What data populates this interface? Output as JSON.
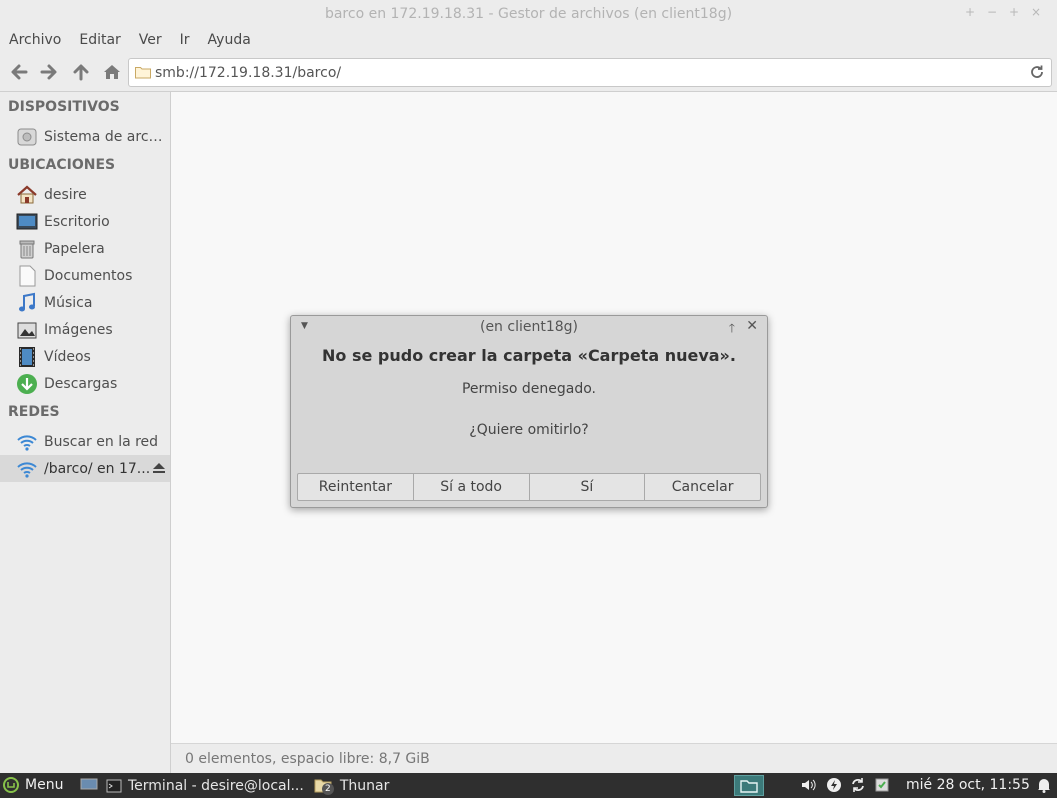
{
  "window": {
    "title": "barco en 172.19.18.31 - Gestor de archivos (en client18g)",
    "controls": [
      "minimize",
      "maximize",
      "restore",
      "close"
    ]
  },
  "menubar": {
    "items": [
      "Archivo",
      "Editar",
      "Ver",
      "Ir",
      "Ayuda"
    ]
  },
  "toolbar": {
    "location": "smb://172.19.18.31/barco/"
  },
  "sidebar": {
    "devices_header": "DISPOSITIVOS",
    "devices": [
      {
        "label": "Sistema de arch...",
        "icon": "drive-icon"
      }
    ],
    "places_header": "UBICACIONES",
    "places": [
      {
        "label": "desire",
        "icon": "home-icon"
      },
      {
        "label": "Escritorio",
        "icon": "desktop-icon"
      },
      {
        "label": "Papelera",
        "icon": "trash-icon"
      },
      {
        "label": "Documentos",
        "icon": "document-icon"
      },
      {
        "label": "Música",
        "icon": "music-icon"
      },
      {
        "label": "Imágenes",
        "icon": "pictures-icon"
      },
      {
        "label": "Vídeos",
        "icon": "video-icon"
      },
      {
        "label": "Descargas",
        "icon": "download-icon"
      }
    ],
    "network_header": "REDES",
    "network": [
      {
        "label": "Buscar en la red",
        "icon": "network-icon"
      },
      {
        "label": "/barco/ en 17...",
        "icon": "network-icon",
        "selected": true
      }
    ]
  },
  "statusbar": {
    "text": "0 elementos, espacio libre: 8,7 GiB"
  },
  "dialog": {
    "title": "(en client18g)",
    "heading": "No se pudo crear la carpeta «Carpeta nueva».",
    "message": "Permiso denegado.",
    "question": "¿Quiere omitirlo?",
    "buttons": [
      "Reintentar",
      "Sí a todo",
      "Sí",
      "Cancelar"
    ]
  },
  "panel": {
    "menu_label": "Menu",
    "tasks": [
      {
        "label": "Terminal - desire@local...",
        "icon": "terminal-icon"
      },
      {
        "label": "Thunar",
        "icon": "folder-icon",
        "count": "2"
      }
    ],
    "clock": "mié 28 oct, 11:55"
  },
  "colors": {
    "panel_bg": "#2f2f2f",
    "accent": "#3c7a7a",
    "dialog_bg": "#d6d6d6"
  }
}
